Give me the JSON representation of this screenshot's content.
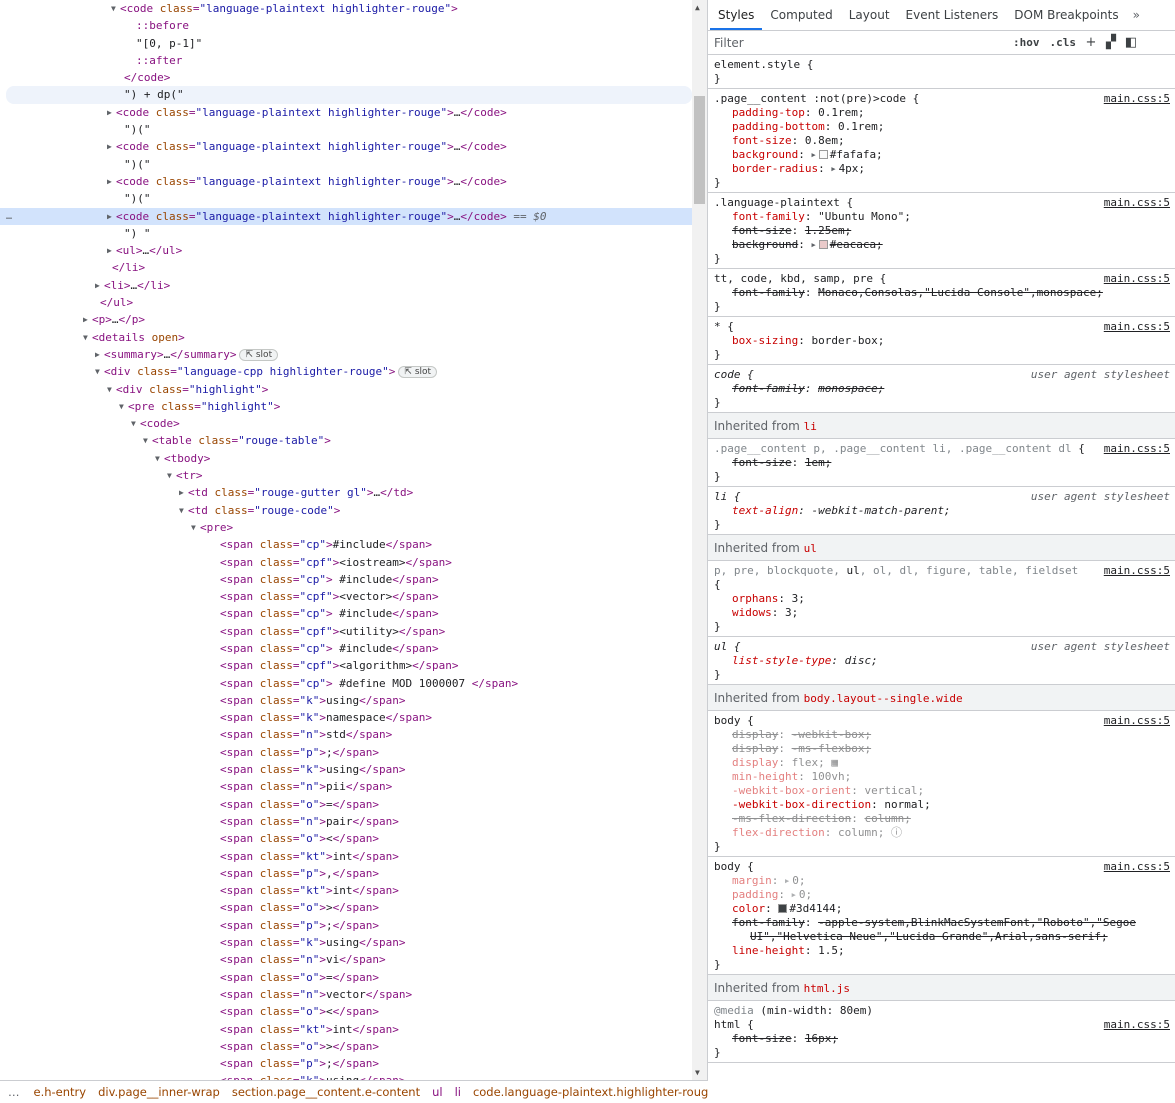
{
  "elements": {
    "rows": [
      {
        "indent": 120,
        "exp": "open",
        "html": "<span class=\"tg\">&lt;code</span> <span class=\"an\">class</span><span class=\"tg\">=</span><span class=\"av\">\"language-plaintext highlighter-rouge\"</span><span class=\"tg\">&gt;</span>"
      },
      {
        "indent": 136,
        "html": "<span class=\"ps\">::before</span>"
      },
      {
        "indent": 136,
        "html": "<span class=\"tx\">\"[0, p-1]\"</span>"
      },
      {
        "indent": 136,
        "html": "<span class=\"ps\">::after</span>"
      },
      {
        "indent": 124,
        "html": "<span class=\"tg\">&lt;/code&gt;</span>"
      },
      {
        "indent": 124,
        "cls": "hover",
        "html": "<span class=\"tx\">\") + dp(\"</span>"
      },
      {
        "indent": 116,
        "exp": "closed",
        "html": "<span class=\"tg\">&lt;code</span> <span class=\"an\">class</span><span class=\"tg\">=</span><span class=\"av\">\"language-plaintext highlighter-rouge\"</span><span class=\"tg\">&gt;</span>…<span class=\"tg\">&lt;/code&gt;</span>"
      },
      {
        "indent": 124,
        "html": "<span class=\"tx\">\")(\"</span>"
      },
      {
        "indent": 116,
        "exp": "closed",
        "html": "<span class=\"tg\">&lt;code</span> <span class=\"an\">class</span><span class=\"tg\">=</span><span class=\"av\">\"language-plaintext highlighter-rouge\"</span><span class=\"tg\">&gt;</span>…<span class=\"tg\">&lt;/code&gt;</span>"
      },
      {
        "indent": 124,
        "html": "<span class=\"tx\">\")(\"</span>"
      },
      {
        "indent": 116,
        "exp": "closed",
        "html": "<span class=\"tg\">&lt;code</span> <span class=\"an\">class</span><span class=\"tg\">=</span><span class=\"av\">\"language-plaintext highlighter-rouge\"</span><span class=\"tg\">&gt;</span>…<span class=\"tg\">&lt;/code&gt;</span>"
      },
      {
        "indent": 124,
        "html": "<span class=\"tx\">\")(\"</span>"
      },
      {
        "indent": 116,
        "exp": "closed",
        "cls": "sel",
        "gutter": "…",
        "html": "<span class=\"tg\">&lt;code</span> <span class=\"an\">class</span><span class=\"tg\">=</span><span class=\"av\">\"language-plaintext highlighter-rouge\"</span><span class=\"tg\">&gt;</span>…<span class=\"tg\">&lt;/code&gt;</span> <span class=\"eq\">== $0</span>"
      },
      {
        "indent": 124,
        "html": "<span class=\"tx\">\") \"</span>"
      },
      {
        "indent": 116,
        "exp": "closed",
        "html": "<span class=\"tg\">&lt;ul&gt;</span>…<span class=\"tg\">&lt;/ul&gt;</span>"
      },
      {
        "indent": 112,
        "html": "<span class=\"tg\">&lt;/li&gt;</span>"
      },
      {
        "indent": 104,
        "exp": "closed",
        "html": "<span class=\"tg\">&lt;li&gt;</span>…<span class=\"tg\">&lt;/li&gt;</span>"
      },
      {
        "indent": 100,
        "html": "<span class=\"tg\">&lt;/ul&gt;</span>"
      },
      {
        "indent": 92,
        "exp": "closed",
        "html": "<span class=\"tg\">&lt;p&gt;</span>…<span class=\"tg\">&lt;/p&gt;</span>"
      },
      {
        "indent": 92,
        "exp": "open",
        "html": "<span class=\"tg\">&lt;details</span> <span class=\"an\">open</span><span class=\"tg\">&gt;</span>"
      },
      {
        "indent": 104,
        "exp": "closed",
        "html": "<span class=\"tg\">&lt;summary&gt;</span>…<span class=\"tg\">&lt;/summary&gt;</span><span class=\"slotb\">⇱ slot</span>"
      },
      {
        "indent": 104,
        "exp": "open",
        "html": "<span class=\"tg\">&lt;div</span> <span class=\"an\">class</span><span class=\"tg\">=</span><span class=\"av\">\"language-cpp highlighter-rouge\"</span><span class=\"tg\">&gt;</span><span class=\"slotb\">⇱ slot</span>"
      },
      {
        "indent": 116,
        "exp": "open",
        "html": "<span class=\"tg\">&lt;div</span> <span class=\"an\">class</span><span class=\"tg\">=</span><span class=\"av\">\"highlight\"</span><span class=\"tg\">&gt;</span>"
      },
      {
        "indent": 128,
        "exp": "open",
        "html": "<span class=\"tg\">&lt;pre</span> <span class=\"an\">class</span><span class=\"tg\">=</span><span class=\"av\">\"highlight\"</span><span class=\"tg\">&gt;</span>"
      },
      {
        "indent": 140,
        "exp": "open",
        "html": "<span class=\"tg\">&lt;code&gt;</span>"
      },
      {
        "indent": 152,
        "exp": "open",
        "html": "<span class=\"tg\">&lt;table</span> <span class=\"an\">class</span><span class=\"tg\">=</span><span class=\"av\">\"rouge-table\"</span><span class=\"tg\">&gt;</span>"
      },
      {
        "indent": 164,
        "exp": "open",
        "html": "<span class=\"tg\">&lt;tbody&gt;</span>"
      },
      {
        "indent": 176,
        "exp": "open",
        "html": "<span class=\"tg\">&lt;tr&gt;</span>"
      },
      {
        "indent": 188,
        "exp": "closed",
        "html": "<span class=\"tg\">&lt;td</span> <span class=\"an\">class</span><span class=\"tg\">=</span><span class=\"av\">\"rouge-gutter gl\"</span><span class=\"tg\">&gt;</span>…<span class=\"tg\">&lt;/td&gt;</span>"
      },
      {
        "indent": 188,
        "exp": "open",
        "html": "<span class=\"tg\">&lt;td</span> <span class=\"an\">class</span><span class=\"tg\">=</span><span class=\"av\">\"rouge-code\"</span><span class=\"tg\">&gt;</span>"
      },
      {
        "indent": 200,
        "exp": "open",
        "html": "<span class=\"tg\">&lt;pre&gt;</span>"
      }
    ],
    "spans": [
      [
        "cp",
        "#include"
      ],
      [
        "cpf",
        "<iostream>"
      ],
      [
        "cp",
        " #include"
      ],
      [
        "cpf",
        "<vector>"
      ],
      [
        "cp",
        " #include"
      ],
      [
        "cpf",
        "<utility>"
      ],
      [
        "cp",
        " #include"
      ],
      [
        "cpf",
        "<algorithm>"
      ],
      [
        "cp",
        " #define MOD 1000007 "
      ],
      [
        "k",
        "using"
      ],
      [
        "k",
        "namespace"
      ],
      [
        "n",
        "std"
      ],
      [
        "p",
        ";"
      ],
      [
        "k",
        "using"
      ],
      [
        "n",
        "pii"
      ],
      [
        "o",
        "="
      ],
      [
        "n",
        "pair"
      ],
      [
        "o",
        "<"
      ],
      [
        "kt",
        "int"
      ],
      [
        "p",
        ","
      ],
      [
        "kt",
        "int"
      ],
      [
        "o",
        ">"
      ],
      [
        "p",
        ";"
      ],
      [
        "k",
        "using"
      ],
      [
        "n",
        "vi"
      ],
      [
        "o",
        "="
      ],
      [
        "n",
        "vector"
      ],
      [
        "o",
        "<"
      ],
      [
        "kt",
        "int"
      ],
      [
        "o",
        ">"
      ],
      [
        "p",
        ";"
      ],
      [
        "k",
        "using"
      ]
    ]
  },
  "breadcrumbs": {
    "more_left": "…",
    "items": [
      "e.h-entry",
      "div.page__inner-wrap",
      "section.page__content.e-content",
      "ul",
      "li",
      "code.language-plaintext.highlighter-rouge"
    ],
    "more_right": "…"
  },
  "styles_pane": {
    "tabs": [
      "Styles",
      "Computed",
      "Layout",
      "Event Listeners",
      "DOM Breakpoints"
    ],
    "active_tab": "Styles",
    "more_tabs_icon": "double-chevron-right-icon",
    "filter_placeholder": "Filter",
    "hov_label": ":hov",
    "cls_label": ".cls",
    "plus_label": "+",
    "colors": {
      "accent": "#1a73e8",
      "property": "#c80000",
      "tag": "#881280",
      "attr": "#994500",
      "attr_value": "#1a1aa6"
    }
  },
  "rules_html": [
    "<div class=\"rule\" data-name=\"rule-element-style\"><div class=\"sel-line\">element.style {</div><div class=\"brace\">}</div></div>",
    "<div class=\"rule\" data-name=\"rule-page-content-code\"><div class=\"sel-line\">.page__content :not(pre)&gt;code {</div><span class=\"src\">main.css:5</span><div class=\"decl\"><span class=\"pn\">padding-top</span>: <span class=\"pv\">0.1rem;</span></div><div class=\"decl\"><span class=\"pn\">padding-bottom</span>: <span class=\"pv\">0.1rem;</span></div><div class=\"decl\"><span class=\"pn\">font-size</span>: <span class=\"pv\">0.8em;</span></div><div class=\"decl\"><span class=\"pn\">background</span>: <span class=\"exp\">▶</span><span class=\"swatch\" style=\"background:#fafafa\"></span><span class=\"pv\">#fafafa;</span></div><div class=\"decl\"><span class=\"pn\">border-radius</span>: <span class=\"exp\">▶</span><span class=\"pv\">4px;</span></div><div class=\"brace\">}</div></div>",
    "<div class=\"rule\" data-name=\"rule-language-plaintext\"><div class=\"sel-line\">.language-plaintext {</div><span class=\"src\">main.css:5</span><div class=\"decl\"><span class=\"pn\">font-family</span>: <span class=\"pv\">\"Ubuntu Mono\";</span></div><div class=\"decl strike\"><span class=\"pn\">font-size</span>: <span class=\"pv\">1.25em;</span></div><div class=\"decl strike\"><span class=\"pn\">background</span>: <span class=\"exp\">▶</span><span class=\"swatch\" style=\"background:#eacaca\"></span><span class=\"pv\">#eacaca;</span></div><div class=\"brace\">}</div></div>",
    "<div class=\"rule\" data-name=\"rule-tt-code\"><div class=\"sel-line\">tt, code, kbd, samp, pre {</div><span class=\"src\">main.css:5</span><div class=\"decl strike\"><span class=\"pn\">font-family</span>: <span class=\"pv\">Monaco,Consolas,\"Lucida Console\",monospace;</span></div><div class=\"brace\">}</div></div>",
    "<div class=\"rule\" data-name=\"rule-universal\"><div class=\"sel-line\">* {</div><span class=\"src\">main.css:5</span><div class=\"decl\"><span class=\"pn\">box-sizing</span>: <span class=\"pv\">border-box;</span></div><div class=\"brace\">}</div></div>",
    "<div class=\"rule\" data-name=\"rule-code-ua\"><div class=\"sel-line italic\">code {</div><span class=\"src ua\">user agent stylesheet</span><div class=\"decl strike italic\"><span class=\"pn\">font-family</span>: <span class=\"pv\">monospace;</span></div><div class=\"brace\">}</div></div>",
    "<div class=\"inherited\" data-name=\"inherited-from-li\">Inherited from <span class=\"ih-el\">li</span></div>",
    "<div class=\"rule\" data-name=\"rule-page-content-p-li-dl\"><div class=\"sel-line\"><span class=\"muted\">.page__content p, .page__content li, .page__content dl</span> {</div><span class=\"src\">main.css:5</span><div class=\"decl strike\"><span class=\"pn\">font-size</span>: <span class=\"pv\">1em;</span></div><div class=\"brace\">}</div></div>",
    "<div class=\"rule\" data-name=\"rule-li-ua\"><div class=\"sel-line italic\">li {</div><span class=\"src ua\">user agent stylesheet</span><div class=\"decl italic\"><span class=\"pn\">text-align</span>: <span class=\"pv\">-webkit-match-parent;</span></div><div class=\"brace\">}</div></div>",
    "<div class=\"inherited\" data-name=\"inherited-from-ul\">Inherited from <span class=\"ih-el\">ul</span></div>",
    "<div class=\"rule\" data-name=\"rule-p-pre-blockquote\"><div class=\"sel-line\"><span class=\"muted\">p, pre, blockquote,</span> ul<span class=\"muted\">, ol, dl, figure, table, fieldset</span></div><span class=\"src\">main.css:5</span><div class=\"sel-line\">{</div><div class=\"decl\"><span class=\"pn\">orphans</span>: <span class=\"pv\">3;</span></div><div class=\"decl\"><span class=\"pn\">widows</span>: <span class=\"pv\">3;</span></div><div class=\"brace\">}</div></div>",
    "<div class=\"rule\" data-name=\"rule-ul-ua\"><div class=\"sel-line italic\">ul {</div><span class=\"src ua\">user agent stylesheet</span><div class=\"decl italic\"><span class=\"pn\">list-style-type</span>: <span class=\"pv\">disc;</span></div><div class=\"brace\">}</div></div>",
    "<div class=\"inherited\" data-name=\"inherited-from-body\">Inherited from <span class=\"ih-el\">body.layout--single.wide</span></div>",
    "<div class=\"rule\" data-name=\"rule-body-1\"><div class=\"sel-line\">body {</div><span class=\"src\">main.css:5</span><div class=\"decl faded strike\"><span class=\"pn\">display</span>: <span class=\"pv\">-webkit-box;</span></div><div class=\"decl faded strike\"><span class=\"pn\">display</span>: <span class=\"pv\">-ms-flexbox;</span></div><div class=\"decl faded\"><span class=\"pn\">display</span>: <span class=\"pv\">flex;</span> <span class=\"pv\">▦</span></div><div class=\"decl faded\"><span class=\"pn\">min-height</span>: <span class=\"pv\">100vh;</span></div><div class=\"decl faded\"><span class=\"pn\">-webkit-box-orient</span>: <span class=\"pv\">vertical;</span></div><div class=\"decl\"><span class=\"pn\">-webkit-box-direction</span>: <span class=\"pv\">normal;</span></div><div class=\"decl faded strike\"><span class=\"pn\">-ms-flex-direction</span>: <span class=\"pv\">column;</span></div><div class=\"decl faded\"><span class=\"pn\">flex-direction</span>: <span class=\"pv\">column;</span> <span class=\"pv\">ⓘ</span></div><div class=\"brace\">}</div></div>",
    "<div class=\"rule\" data-name=\"rule-body-2\"><div class=\"sel-line\">body {</div><span class=\"src\">main.css:5</span><div class=\"decl faded\"><span class=\"pn\">margin</span>: <span class=\"exp\">▶</span><span class=\"pv\">0;</span></div><div class=\"decl faded\"><span class=\"pn\">padding</span>: <span class=\"exp\">▶</span><span class=\"pv\">0;</span></div><div class=\"decl\"><span class=\"pn\">color</span>: <span class=\"swatch\" style=\"background:#3d4144\"></span><span class=\"pv\">#3d4144;</span></div><div class=\"decl strike\"><span class=\"pn\">font-family</span>: <span class=\"pv\">-apple-system,BlinkMacSystemFont,\"Roboto\",\"Segoe</span></div><div class=\"decl strike wrap2\"><span class=\"pv\">UI\",\"Helvetica Neue\",\"Lucida Grande\",Arial,sans-serif;</span></div><div class=\"decl\"><span class=\"pn\">line-height</span>: <span class=\"pv\">1.5;</span></div><div class=\"brace\">}</div></div>",
    "<div class=\"inherited\" data-name=\"inherited-from-html\">Inherited from <span class=\"ih-el\">html.js</span></div>",
    "<div class=\"rule\" data-name=\"rule-media-html\"><div class=\"sel-line\"><span class=\"muted\">@media</span> (min-width: 80em)</div><div class=\"sel-line\">html {</div><span class=\"src\" style=\"top:17px\">main.css:5</span><div class=\"decl strike\"><span class=\"pn\">font-size</span>: <span class=\"pv\">16px;</span></div><div class=\"brace\">}</div></div>"
  ]
}
